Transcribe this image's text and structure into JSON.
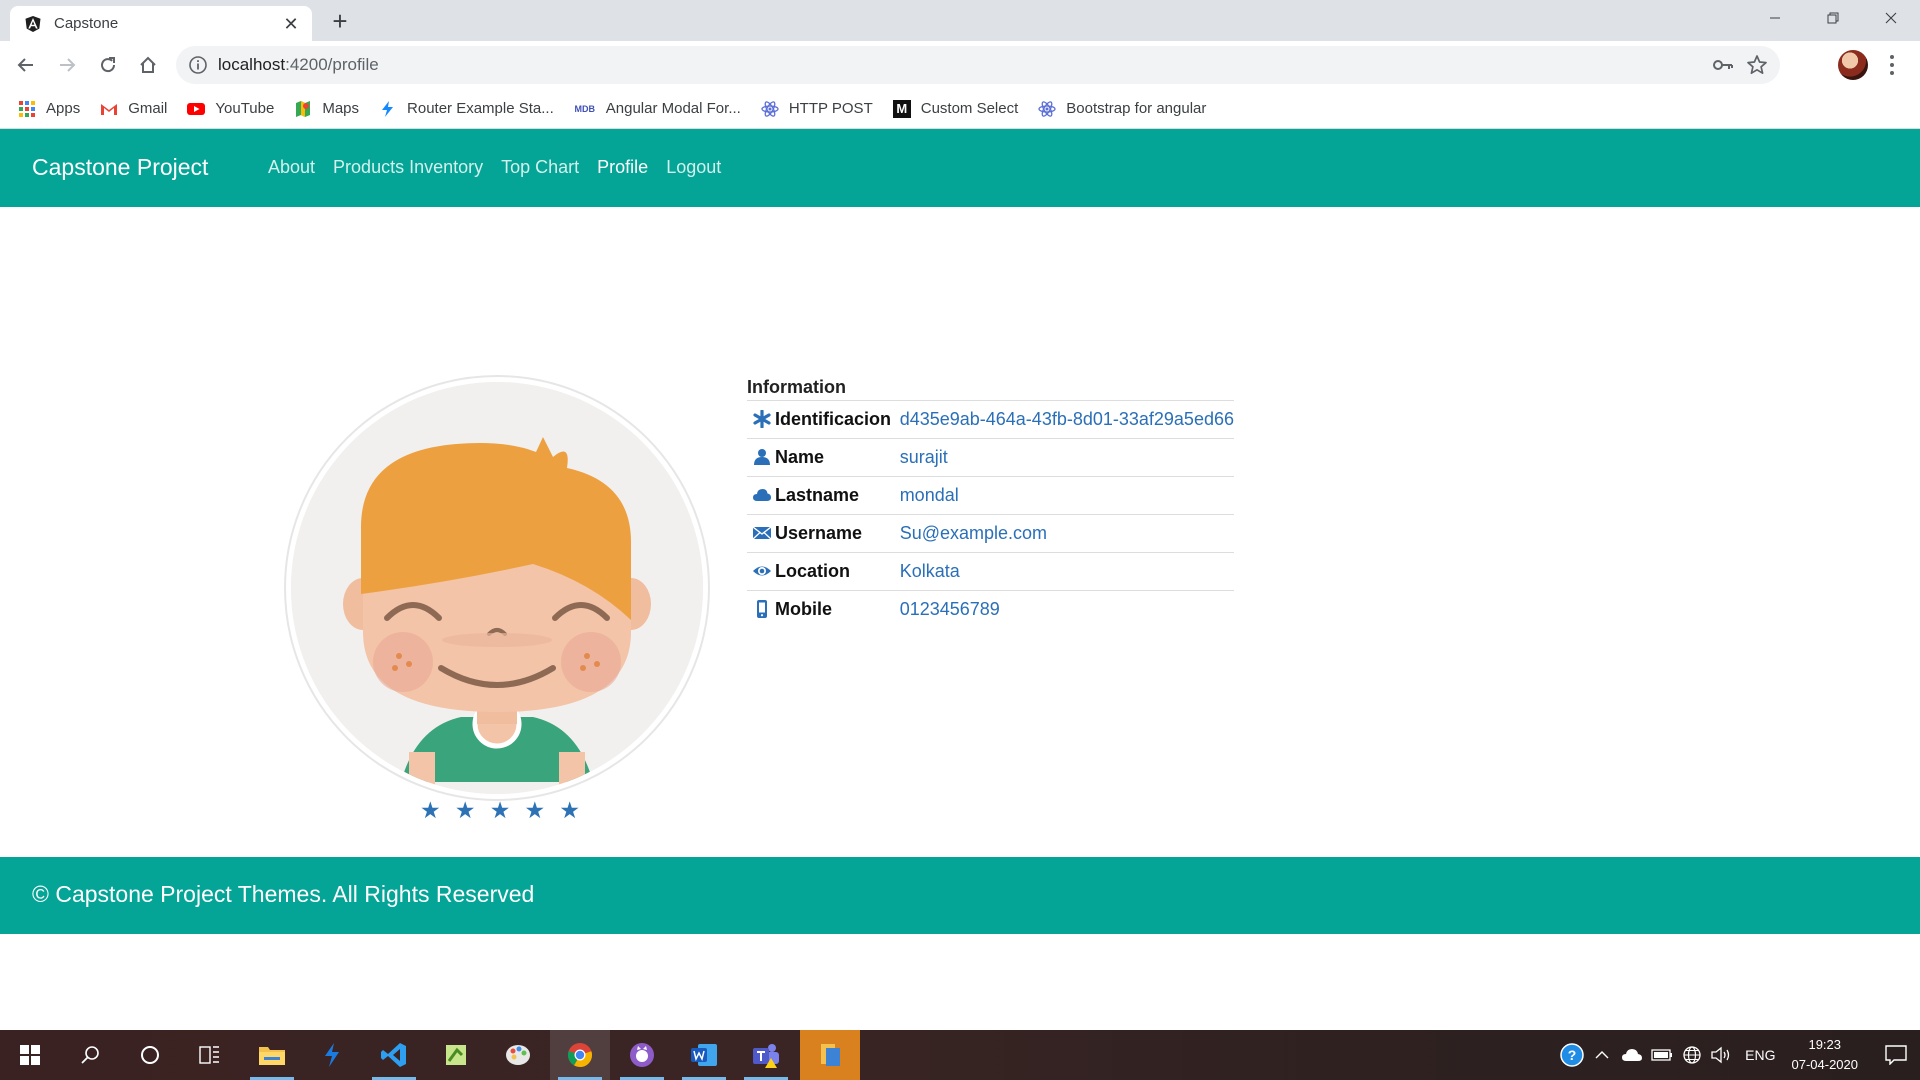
{
  "browser": {
    "tab_title": "Capstone",
    "url_host": "localhost",
    "url_rest": ":4200/profile",
    "bookmarks": [
      {
        "label": "Apps",
        "icon": "apps-grid-icon"
      },
      {
        "label": "Gmail",
        "icon": "gmail-icon"
      },
      {
        "label": "YouTube",
        "icon": "youtube-icon"
      },
      {
        "label": "Maps",
        "icon": "maps-icon"
      },
      {
        "label": "Router Example Sta...",
        "icon": "stackblitz-icon"
      },
      {
        "label": "Angular Modal For...",
        "icon": "mdb-icon"
      },
      {
        "label": "HTTP POST",
        "icon": "react-icon"
      },
      {
        "label": "Custom Select",
        "icon": "medium-icon"
      },
      {
        "label": "Bootstrap for angular",
        "icon": "react-icon"
      }
    ],
    "mdb_badge": "MDB",
    "medium_badge": "M"
  },
  "navbar": {
    "brand": "Capstone Project",
    "links": [
      "About",
      "Products Inventory",
      "Top Chart",
      "Profile",
      "Logout"
    ],
    "active": "Profile"
  },
  "profile": {
    "rating_stars": 5,
    "star_glyph": "★",
    "heading": "Information",
    "rows": [
      {
        "label": "Identificacion",
        "value": "d435e9ab-464a-43fb-8d01-33af29a5ed66",
        "icon": "asterisk-icon"
      },
      {
        "label": "Name",
        "value": "surajit",
        "icon": "user-icon"
      },
      {
        "label": "Lastname",
        "value": "mondal",
        "icon": "cloud-icon"
      },
      {
        "label": "Username",
        "value": "Su@example.com",
        "icon": "envelope-icon"
      },
      {
        "label": "Location",
        "value": "Kolkata",
        "icon": "eye-icon"
      },
      {
        "label": "Mobile",
        "value": "0123456789",
        "icon": "phone-icon"
      }
    ]
  },
  "footer": {
    "text": "© Capstone Project Themes. All Rights Reserved"
  },
  "taskbar": {
    "language": "ENG",
    "time": "19:23",
    "date": "07-04-2020"
  },
  "colors": {
    "primary": "#04a597",
    "link": "#2a6fb8",
    "star": "#2c72b5"
  }
}
